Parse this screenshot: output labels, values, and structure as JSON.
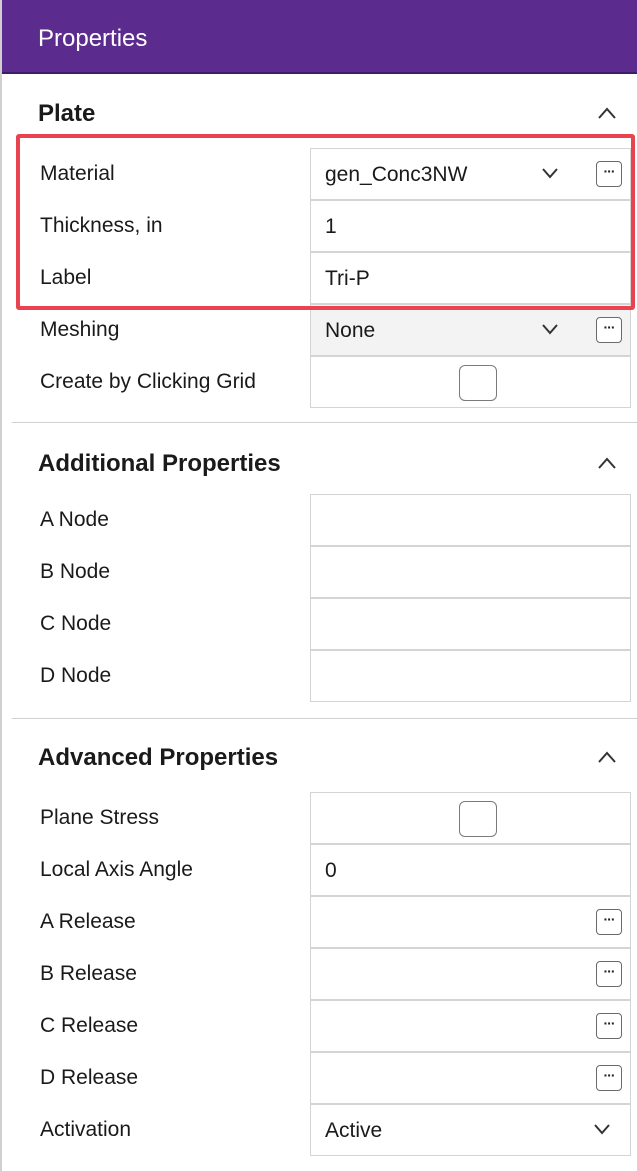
{
  "window": {
    "title": "Properties"
  },
  "sections": {
    "plate": {
      "title": "Plate",
      "caret_icon": "chevron-up-icon",
      "rows": {
        "material": {
          "label": "Material",
          "value": "gen_Conc3NW",
          "dropdown_icon": "chevron-down-icon",
          "button_label": "···"
        },
        "thickness": {
          "label": "Thickness, in",
          "value": "1"
        },
        "label": {
          "label": "Label",
          "value": "Tri-P"
        },
        "meshing": {
          "label": "Meshing",
          "value": "None",
          "dropdown_icon": "chevron-down-icon",
          "button_label": "···"
        },
        "create_by_clicking_grid": {
          "label": "Create by Clicking Grid",
          "checked": false
        }
      }
    },
    "additional": {
      "title": "Additional Properties",
      "caret_icon": "chevron-up-icon",
      "rows": {
        "a_node": {
          "label": "A Node",
          "value": ""
        },
        "b_node": {
          "label": "B Node",
          "value": ""
        },
        "c_node": {
          "label": "C Node",
          "value": ""
        },
        "d_node": {
          "label": "D Node",
          "value": ""
        }
      }
    },
    "advanced": {
      "title": "Advanced Properties",
      "caret_icon": "chevron-up-icon",
      "rows": {
        "plane_stress": {
          "label": "Plane Stress",
          "checked": false
        },
        "local_axis_angle": {
          "label": "Local Axis Angle",
          "value": "0"
        },
        "a_release": {
          "label": "A Release",
          "value": "",
          "button_label": "···"
        },
        "b_release": {
          "label": "B Release",
          "value": "",
          "button_label": "···"
        },
        "c_release": {
          "label": "C Release",
          "value": "",
          "button_label": "···"
        },
        "d_release": {
          "label": "D Release",
          "value": "",
          "button_label": "···"
        },
        "activation": {
          "label": "Activation",
          "value": "Active",
          "dropdown_icon": "chevron-down-icon"
        }
      }
    }
  },
  "colors": {
    "title_bar": "#5b2c8e",
    "highlight": "#e8434f",
    "readonly_cell": "#f3f3f3"
  }
}
